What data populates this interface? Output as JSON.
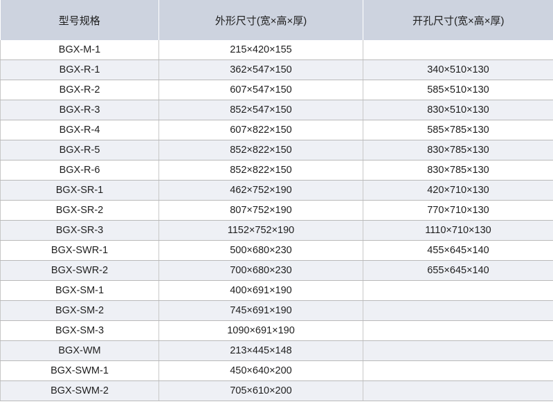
{
  "table": {
    "headers": [
      "型号规格",
      "外形尺寸(宽×高×厚)",
      "开孔尺寸(宽×高×厚)"
    ],
    "rows": [
      [
        "BGX-M-1",
        "215×420×155",
        ""
      ],
      [
        "BGX-R-1",
        "362×547×150",
        "340×510×130"
      ],
      [
        "BGX-R-2",
        "607×547×150",
        "585×510×130"
      ],
      [
        "BGX-R-3",
        "852×547×150",
        "830×510×130"
      ],
      [
        "BGX-R-4",
        "607×822×150",
        "585×785×130"
      ],
      [
        "BGX-R-5",
        "852×822×150",
        "830×785×130"
      ],
      [
        "BGX-R-6",
        "852×822×150",
        "830×785×130"
      ],
      [
        "BGX-SR-1",
        "462×752×190",
        "420×710×130"
      ],
      [
        "BGX-SR-2",
        "807×752×190",
        "770×710×130"
      ],
      [
        "BGX-SR-3",
        "1152×752×190",
        "1110×710×130"
      ],
      [
        "BGX-SWR-1",
        "500×680×230",
        "455×645×140"
      ],
      [
        "BGX-SWR-2",
        "700×680×230",
        "655×645×140"
      ],
      [
        "BGX-SM-1",
        "400×691×190",
        ""
      ],
      [
        "BGX-SM-2",
        "745×691×190",
        ""
      ],
      [
        "BGX-SM-3",
        "1090×691×190",
        ""
      ],
      [
        "BGX-WM",
        "213×445×148",
        ""
      ],
      [
        "BGX-SWM-1",
        "450×640×200",
        ""
      ],
      [
        "BGX-SWM-2",
        "705×610×200",
        ""
      ]
    ]
  },
  "colors": {
    "header_bg": "#cdd3df",
    "stripe_bg": "#eef0f5",
    "border": "#b9b9b9"
  }
}
